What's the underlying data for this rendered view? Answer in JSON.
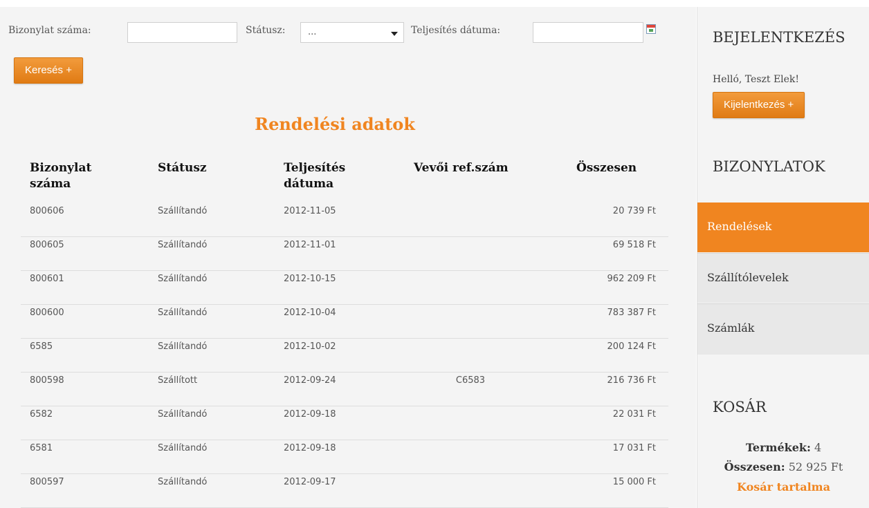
{
  "filters": {
    "doc_number_label": "Bizonylat száma:",
    "doc_number_value": "",
    "status_label": "Státusz:",
    "status_selected": "...",
    "date_label": "Teljesítés dátuma:",
    "date_value": "",
    "search_button": "Keresés  +"
  },
  "page_title": "Rendelési adatok",
  "table": {
    "columns": [
      "Bizonylat száma",
      "Státusz",
      "Teljesítés dátuma",
      "Vevői ref.szám",
      "Összesen"
    ],
    "rows": [
      {
        "number": "800606",
        "status": "Szállítandó",
        "date": "2012-11-05",
        "ref": "",
        "total": "20 739 Ft"
      },
      {
        "number": "800605",
        "status": "Szállítandó",
        "date": "2012-11-01",
        "ref": "",
        "total": "69 518 Ft"
      },
      {
        "number": "800601",
        "status": "Szállítandó",
        "date": "2012-10-15",
        "ref": "",
        "total": "962 209 Ft"
      },
      {
        "number": "800600",
        "status": "Szállítandó",
        "date": "2012-10-04",
        "ref": "",
        "total": "783 387 Ft"
      },
      {
        "number": "6585",
        "status": "Szállítandó",
        "date": "2012-10-02",
        "ref": "",
        "total": "200 124 Ft"
      },
      {
        "number": "800598",
        "status": "Szállított",
        "date": "2012-09-24",
        "ref": "C6583",
        "total": "216 736 Ft"
      },
      {
        "number": "6582",
        "status": "Szállítandó",
        "date": "2012-09-18",
        "ref": "",
        "total": "22 031 Ft"
      },
      {
        "number": "6581",
        "status": "Szállítandó",
        "date": "2012-09-18",
        "ref": "",
        "total": "17 031 Ft"
      },
      {
        "number": "800597",
        "status": "Szállítandó",
        "date": "2012-09-17",
        "ref": "",
        "total": "15 000 Ft"
      }
    ]
  },
  "sidebar": {
    "login_heading": "BEJELENTKEZÉS",
    "greeting": "Helló, Teszt Elek!",
    "logout_button": "Kijelentkezés  +",
    "docs_heading": "BIZONYLATOK",
    "nav": [
      {
        "label": "Rendelések",
        "active": true
      },
      {
        "label": "Szállítólevelek",
        "active": false
      },
      {
        "label": "Számlák",
        "active": false
      }
    ],
    "cart_heading": "KOSÁR",
    "cart_products_label": "Termékek:",
    "cart_products_value": "4",
    "cart_total_label": "Összesen:",
    "cart_total_value": "52 925 Ft",
    "cart_link": "Kosár tartalma"
  },
  "colors": {
    "accent": "#f08520",
    "background": "#f4f4f4",
    "nav_inactive": "#e8e8e8"
  },
  "icons": {
    "status_dropdown": "caret-down-icon",
    "date_picker": "calendar-icon"
  }
}
